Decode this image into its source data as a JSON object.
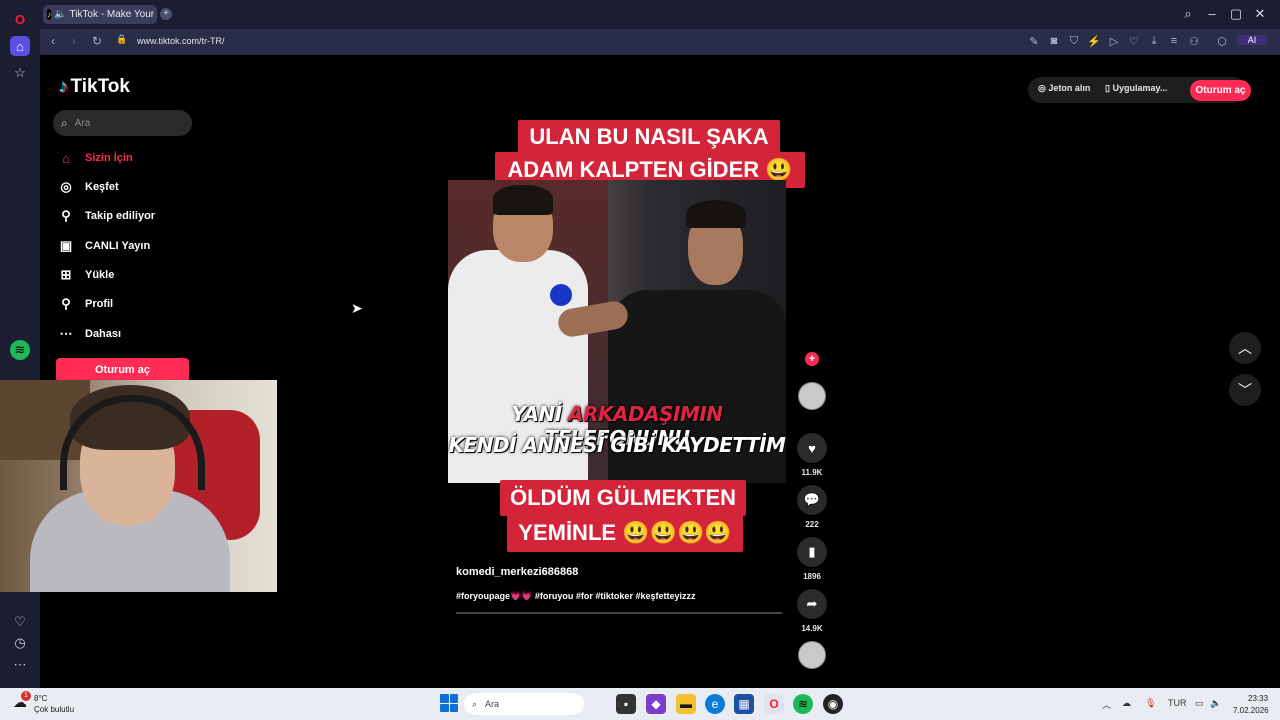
{
  "browser": {
    "tab_title": "TikTok - Make Your Da",
    "new_tab_symbol": "+",
    "url": "www.tiktok.com/tr-TR/",
    "ai_label": "AI"
  },
  "page": {
    "logo_text": "TikTok",
    "search_placeholder": "Ara",
    "nav": [
      {
        "label": "Sizin İçin",
        "icon": "home-icon",
        "active": true
      },
      {
        "label": "Keşfet",
        "icon": "compass-icon"
      },
      {
        "label": "Takip ediliyor",
        "icon": "following-icon"
      },
      {
        "label": "CANLI Yayın",
        "icon": "live-icon"
      },
      {
        "label": "Yükle",
        "icon": "upload-icon"
      },
      {
        "label": "Profil",
        "icon": "profile-icon"
      },
      {
        "label": "Dahası",
        "icon": "more-icon"
      }
    ],
    "login_button": "Oturum aç",
    "top_right": {
      "coins": "Jeton alın",
      "app": "Uygulamay...",
      "login": "Oturum aç"
    },
    "accent_color": "#fe2c55"
  },
  "video": {
    "top_caption_line1": "ULAN BU NASIL ŞAKA",
    "top_caption_line2": "ADAM KALPTEN GİDER 😃",
    "top_caption_line3": "😃😃😃😃",
    "subtitle_pre": "YANİ ",
    "subtitle_red": "ARKADAŞIMIN",
    "subtitle_post": " TELEFONUNU",
    "subtitle_line2": "KENDİ ANNESİ GİBİ KAYDETTİM",
    "bottom_caption_line1": "ÖLDÜM GÜLMEKTEN",
    "bottom_caption_line2": "YEMİNLE 😃😃😃😃",
    "author": "komedi_merkezi686868",
    "hashtags": "#foryoupage💗💗 #foruyou #for #tiktoker #keşfetteyizzz"
  },
  "actions": {
    "likes": "11.9K",
    "comments": "222",
    "saves": "1896",
    "shares": "14.9K"
  },
  "taskbar": {
    "temperature": "8°C",
    "weather": "Çok bulutlu",
    "search": "Ara",
    "language": "TUR",
    "time": "23:33",
    "date": "7.02.2026",
    "notification_count": "1"
  }
}
